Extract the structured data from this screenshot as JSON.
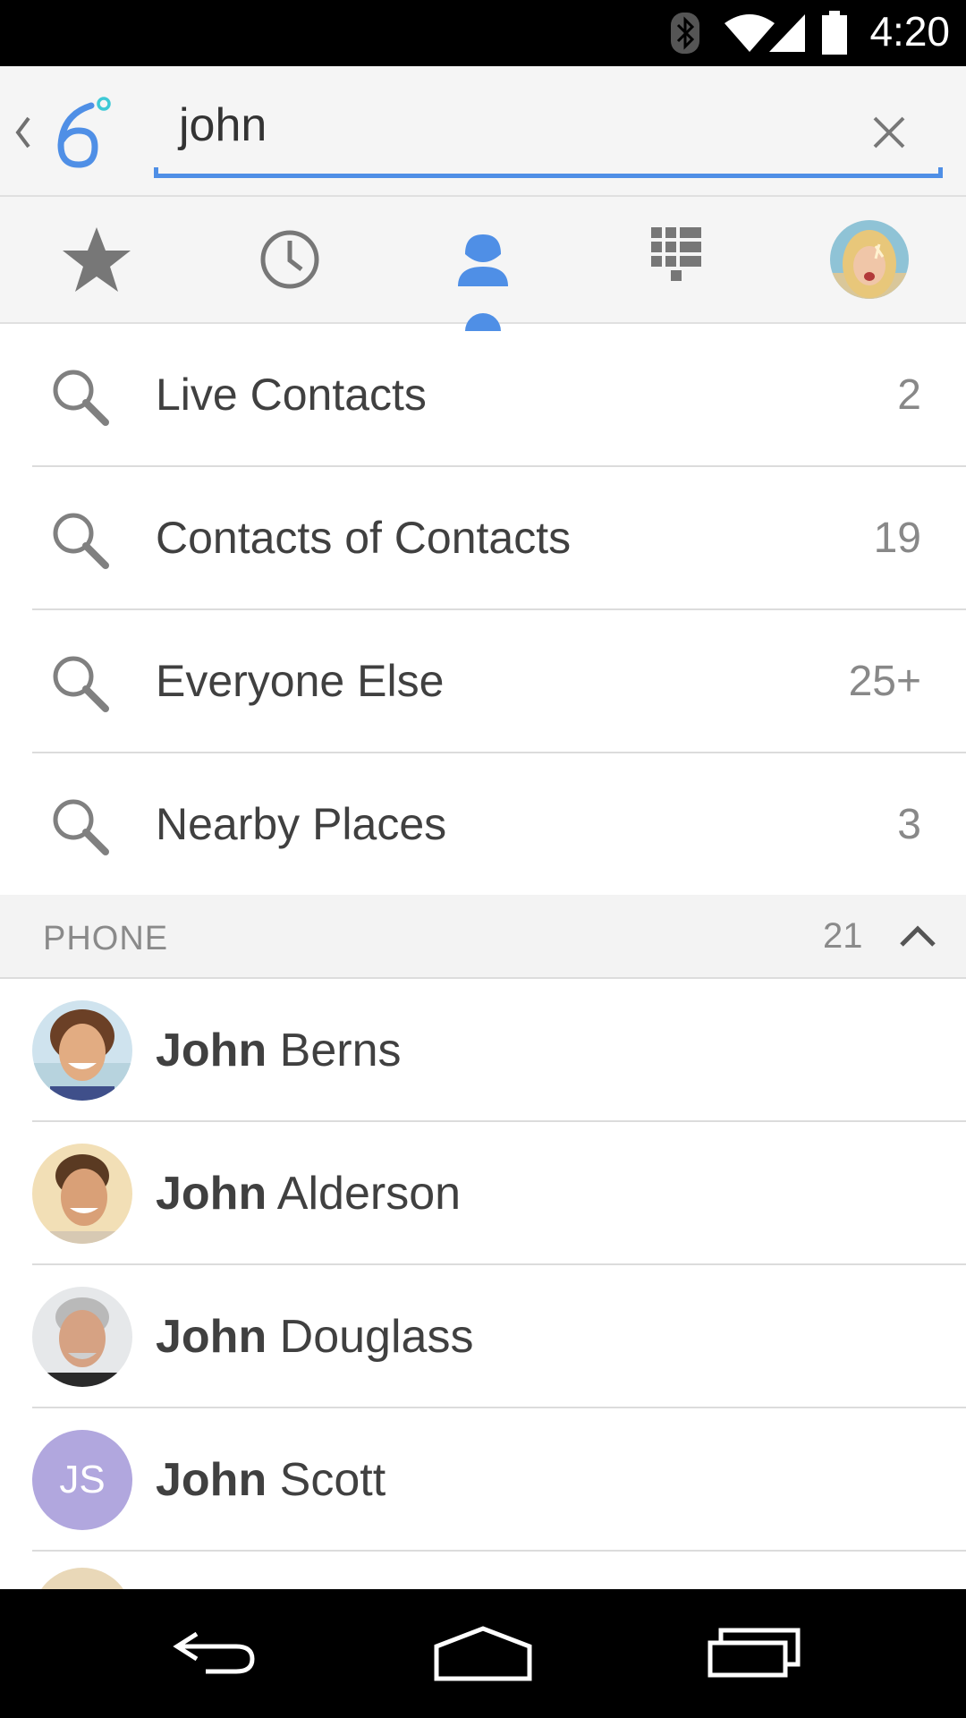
{
  "status_bar": {
    "time": "4:20",
    "icons": [
      "bluetooth-icon",
      "wifi-icon",
      "signal-icon",
      "battery-icon"
    ]
  },
  "search": {
    "query": "john",
    "logo_icon": "sixdegrees-logo-icon",
    "clear_icon": "close-icon",
    "back_icon": "chevron-left-icon"
  },
  "tabs": [
    {
      "name": "favorites",
      "icon": "star-icon",
      "active": false
    },
    {
      "name": "recents",
      "icon": "clock-icon",
      "active": false
    },
    {
      "name": "contacts",
      "icon": "person-icon",
      "active": true
    },
    {
      "name": "dialpad",
      "icon": "dialpad-icon",
      "active": false
    },
    {
      "name": "profile",
      "icon": "profile-avatar",
      "active": false
    }
  ],
  "search_categories": [
    {
      "label": "Live Contacts",
      "count": "2"
    },
    {
      "label": "Contacts of Contacts",
      "count": "19"
    },
    {
      "label": "Everyone Else",
      "count": "25+"
    },
    {
      "label": "Nearby Places",
      "count": "3"
    }
  ],
  "phone_section": {
    "title": "PHONE",
    "count": "21"
  },
  "contacts": [
    {
      "first": "John",
      "last": " Berns",
      "avatar": "photo"
    },
    {
      "first": "John",
      "last": " Alderson",
      "avatar": "photo"
    },
    {
      "first": "John",
      "last": " Douglass",
      "avatar": "photo"
    },
    {
      "first": "John",
      "last": " Scott",
      "avatar": "initials",
      "initials": "JS"
    }
  ],
  "colors": {
    "accent": "#4f8fe6",
    "initials_avatar": "#b1a7de"
  }
}
